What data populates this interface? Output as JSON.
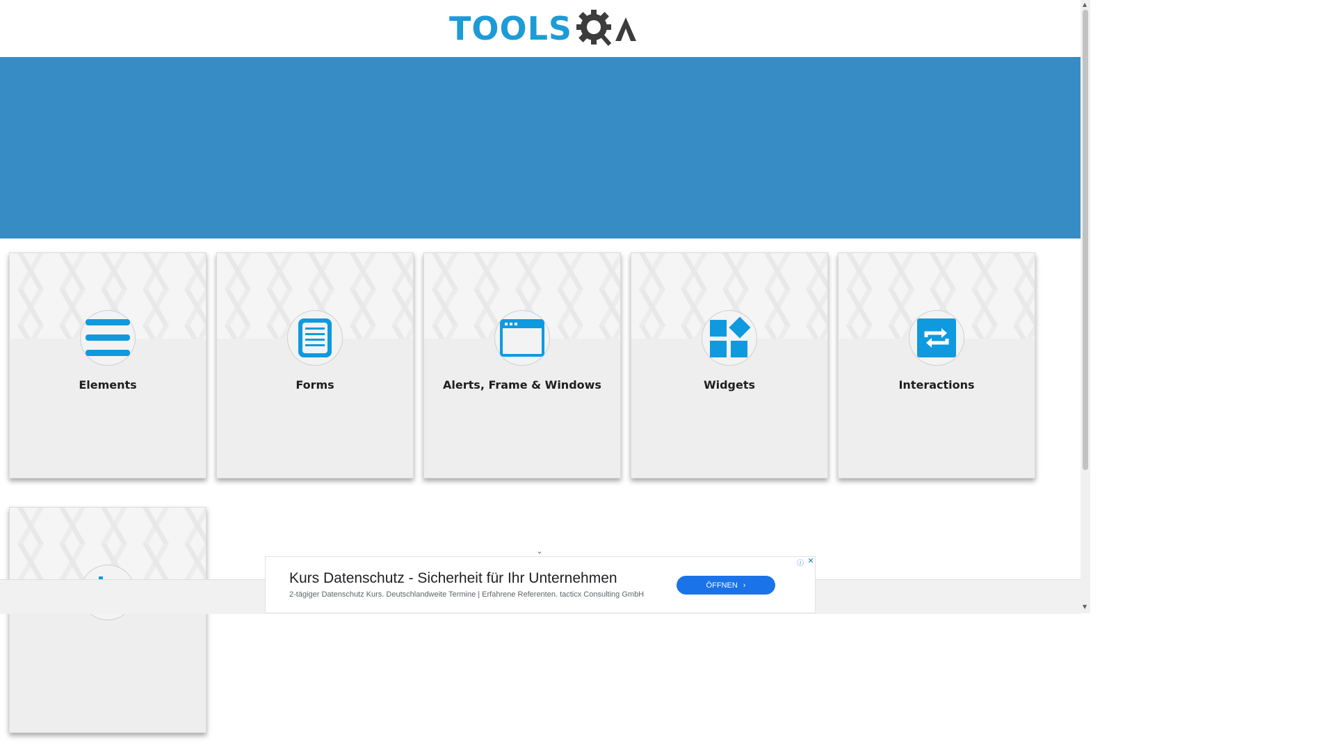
{
  "header": {
    "logo_tools": "TOOLS",
    "logo_qa": "QA"
  },
  "colors": {
    "accent": "#1d9bd7",
    "banner": "#388cc5",
    "card_bg": "#eeeeee"
  },
  "cards": [
    {
      "label": "Elements",
      "icon": "menu-icon"
    },
    {
      "label": "Forms",
      "icon": "document-icon"
    },
    {
      "label": "Alerts, Frame & Windows",
      "icon": "browser-window-icon"
    },
    {
      "label": "Widgets",
      "icon": "widgets-icon"
    },
    {
      "label": "Interactions",
      "icon": "sync-arrows-icon"
    },
    {
      "label": "",
      "icon": "bookstore-icon"
    }
  ],
  "ad": {
    "title": "Kurs Datenschutz - Sicherheit für Ihr Unternehmen",
    "description": "2-tägiger Datenschutz Kurs. Deutschlandweite Termine | Erfahrene Referenten. tacticx Consulting GmbH",
    "button_label": "ÖFFNEN",
    "info_icon": "info-icon",
    "close_icon": "close-icon"
  }
}
